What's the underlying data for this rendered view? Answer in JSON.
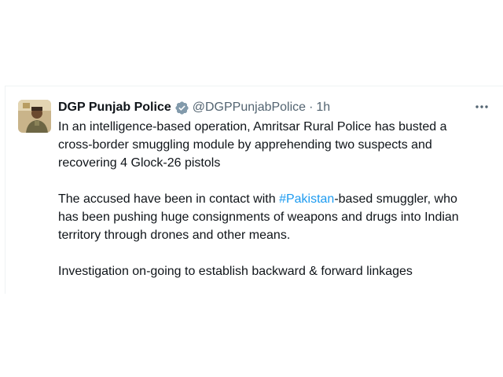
{
  "tweet": {
    "display_name": "DGP Punjab Police",
    "handle": "@DGPPunjabPolice",
    "separator": "·",
    "time": "1h",
    "paragraph1": {
      "line1": "In an intelligence-based operation, Amritsar Rural Police has busted a",
      "line2": "cross-border smuggling module by apprehending two suspects and",
      "line3": "recovering 4 Glock-26 pistols"
    },
    "paragraph2": {
      "line1_before": "The accused have been in contact with ",
      "hashtag": "#Pakistan",
      "line1_after": "-based smuggler, who",
      "line2": "has been pushing huge consignments of weapons and drugs into Indian",
      "line3": "territory through drones and other means."
    },
    "paragraph3": {
      "line1": "Investigation on-going to establish backward & forward linkages"
    }
  },
  "icons": {
    "verified": "verified-badge-icon",
    "more": "more-options-icon"
  },
  "colors": {
    "text": "#0f1419",
    "secondary": "#536471",
    "link": "#1d9bf0",
    "verified_badge": "#829aab",
    "border": "#eff3f4"
  }
}
